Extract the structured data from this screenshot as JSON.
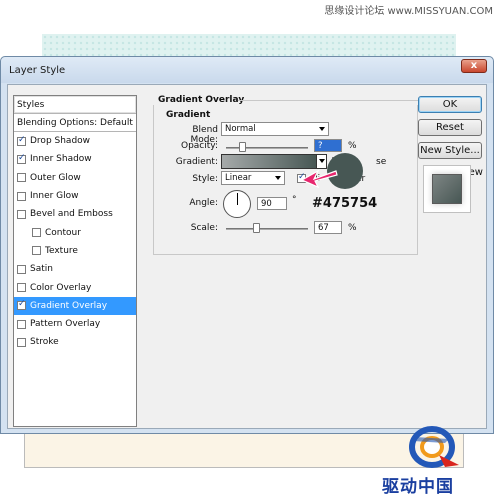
{
  "watermark": "思缘设计论坛  www.MISSYUAN.COM",
  "dialog": {
    "title": "Layer Style",
    "close_label": "x"
  },
  "styles_panel": {
    "header": "Styles",
    "blending_options": "Blending Options: Default",
    "items": [
      {
        "label": "Drop Shadow",
        "checked": true,
        "indent": false,
        "selected": false
      },
      {
        "label": "Inner Shadow",
        "checked": true,
        "indent": false,
        "selected": false
      },
      {
        "label": "Outer Glow",
        "checked": false,
        "indent": false,
        "selected": false
      },
      {
        "label": "Inner Glow",
        "checked": false,
        "indent": false,
        "selected": false
      },
      {
        "label": "Bevel and Emboss",
        "checked": false,
        "indent": false,
        "selected": false
      },
      {
        "label": "Contour",
        "checked": false,
        "indent": true,
        "selected": false
      },
      {
        "label": "Texture",
        "checked": false,
        "indent": true,
        "selected": false
      },
      {
        "label": "Satin",
        "checked": false,
        "indent": false,
        "selected": false
      },
      {
        "label": "Color Overlay",
        "checked": false,
        "indent": false,
        "selected": false
      },
      {
        "label": "Gradient Overlay",
        "checked": true,
        "indent": false,
        "selected": true
      },
      {
        "label": "Pattern Overlay",
        "checked": false,
        "indent": false,
        "selected": false
      },
      {
        "label": "Stroke",
        "checked": false,
        "indent": false,
        "selected": false
      }
    ]
  },
  "gradient_overlay": {
    "section_title": "Gradient Overlay",
    "group_title": "Gradient",
    "blend_mode_label": "Blend Mode:",
    "blend_mode_value": "Normal",
    "opacity_label": "Opacity:",
    "opacity_value": "?",
    "opacity_unit": "%",
    "gradient_label": "Gradient:",
    "reverse_label": "se",
    "style_label": "Style:",
    "style_value": "Linear",
    "align_label": "Ali",
    "layer_label": "er",
    "angle_label": "Angle:",
    "angle_value": "90",
    "angle_unit": "°",
    "scale_label": "Scale:",
    "scale_value": "67",
    "scale_unit": "%",
    "gradient_colors": [
      "#a6aaaa",
      "#475754"
    ]
  },
  "buttons": {
    "ok": "OK",
    "reset": "Reset",
    "new_style": "New Style...",
    "preview_label": "Preview",
    "preview_checked": true
  },
  "annotation": {
    "hex": "#475754",
    "swatch_color": "#475754",
    "arrow_color": "#e8266e"
  },
  "brand": {
    "text": "驱动中国"
  }
}
